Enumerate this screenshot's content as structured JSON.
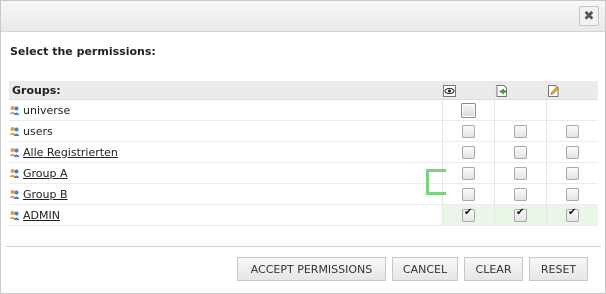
{
  "dialog": {
    "close_glyph": "✖"
  },
  "heading": "Select the permissions:",
  "table": {
    "groups_header": "Groups:",
    "columns": [
      {
        "icon": "view-icon"
      },
      {
        "icon": "add-icon"
      },
      {
        "icon": "edit-icon"
      }
    ],
    "rows": [
      {
        "name": "universe",
        "link": false,
        "checks": [
          "big",
          null,
          null
        ]
      },
      {
        "name": "users",
        "link": false,
        "checks": [
          false,
          false,
          false
        ]
      },
      {
        "name": "Alle Registrierten",
        "link": true,
        "checks": [
          false,
          false,
          false
        ]
      },
      {
        "name": "Group A",
        "link": true,
        "checks": [
          false,
          false,
          false
        ]
      },
      {
        "name": "Group B",
        "link": true,
        "checks": [
          false,
          false,
          false
        ]
      },
      {
        "name": "ADMIN",
        "link": true,
        "checks": [
          true,
          true,
          true
        ]
      }
    ]
  },
  "buttons": {
    "accept": "ACCEPT PERMISSIONS",
    "cancel": "CANCEL",
    "clear": "CLEAR",
    "reset": "RESET"
  },
  "colors": {
    "admin_row_highlight": "#e9f8e6",
    "cursor_bracket": "#7dd37a"
  }
}
